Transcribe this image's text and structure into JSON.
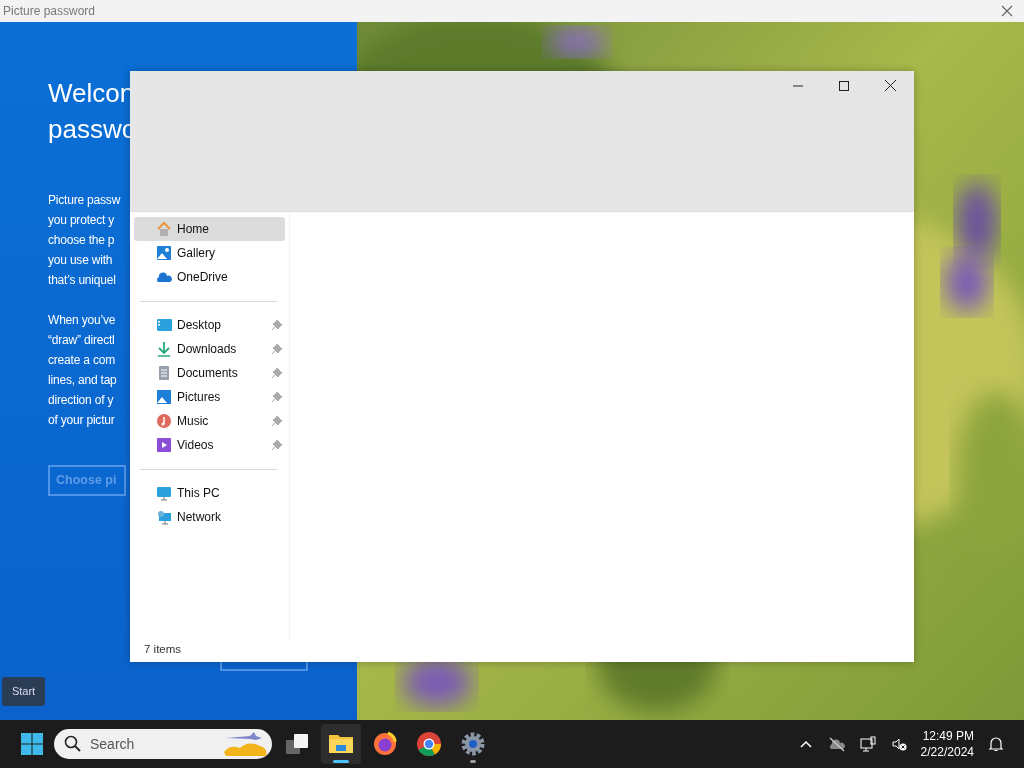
{
  "title_bar": {
    "title": "Picture password"
  },
  "setup_panel": {
    "heading_lines": [
      "Welcon",
      "passwo"
    ],
    "paragraphs": [
      [
        "Picture passw",
        "you protect y",
        "choose the p",
        "you use with",
        "that’s uniquel"
      ],
      [
        "When you’ve",
        "“draw” directl",
        "create a com",
        "lines, and tap",
        "direction of y",
        "of your pictur"
      ]
    ],
    "button": "Choose pi"
  },
  "explorer": {
    "sidebar": {
      "groups": [
        [
          {
            "kind": "home",
            "label": "Home",
            "selected": true,
            "pinned": false
          },
          {
            "kind": "gallery",
            "label": "Gallery",
            "selected": false,
            "pinned": false
          },
          {
            "kind": "onedrive",
            "label": "OneDrive",
            "selected": false,
            "pinned": false
          }
        ],
        [
          {
            "kind": "desktop",
            "label": "Desktop",
            "selected": false,
            "pinned": true
          },
          {
            "kind": "downloads",
            "label": "Downloads",
            "selected": false,
            "pinned": true
          },
          {
            "kind": "documents",
            "label": "Documents",
            "selected": false,
            "pinned": true
          },
          {
            "kind": "pictures",
            "label": "Pictures",
            "selected": false,
            "pinned": true
          },
          {
            "kind": "music",
            "label": "Music",
            "selected": false,
            "pinned": true
          },
          {
            "kind": "videos",
            "label": "Videos",
            "selected": false,
            "pinned": true
          }
        ],
        [
          {
            "kind": "pc",
            "label": "This PC",
            "selected": false,
            "pinned": false
          },
          {
            "kind": "network",
            "label": "Network",
            "selected": false,
            "pinned": false
          }
        ]
      ]
    },
    "status": "7 items"
  },
  "tooltip": "Start",
  "taskbar": {
    "search": {
      "placeholder": "Search"
    },
    "apps": [
      {
        "kind": "explorer",
        "active": true,
        "running": true
      },
      {
        "kind": "firefox",
        "active": false,
        "running": false
      },
      {
        "kind": "chrome",
        "active": false,
        "running": false
      },
      {
        "kind": "settings",
        "active": false,
        "running": true
      }
    ],
    "clock": {
      "time": "12:49 PM",
      "date": "2/22/2024"
    }
  }
}
